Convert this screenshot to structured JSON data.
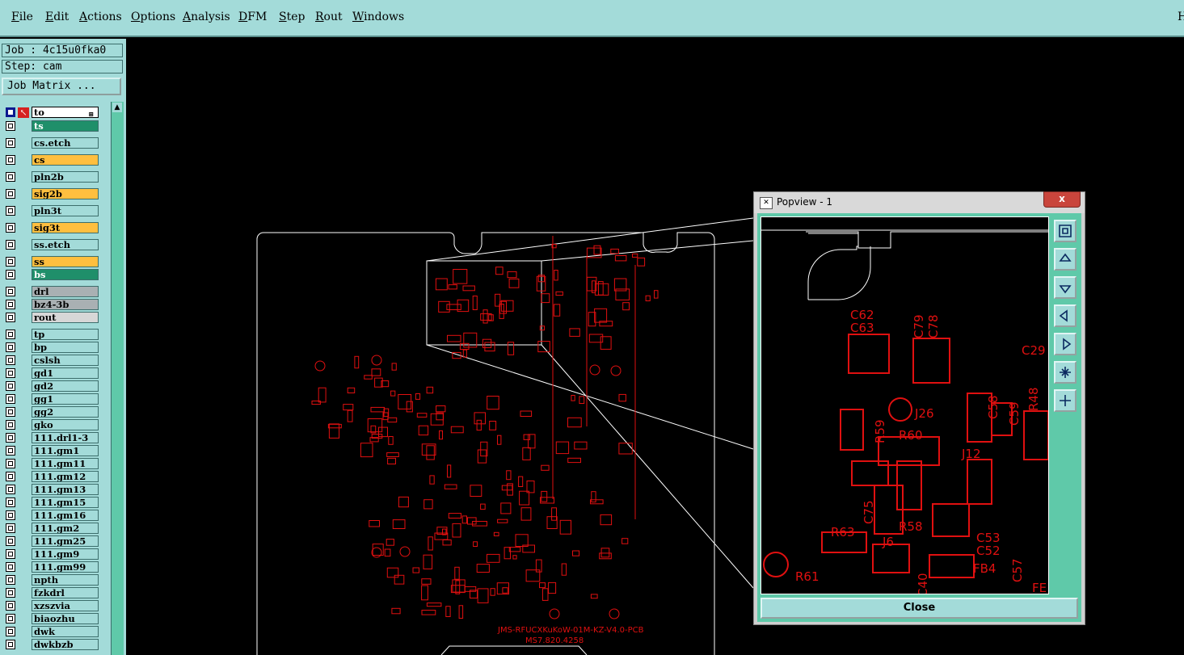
{
  "menu": [
    "File",
    "Edit",
    "Actions",
    "Options",
    "Analysis",
    "DFM",
    "Step",
    "Rout",
    "Windows"
  ],
  "menu_right": "H",
  "job_label": "Job : 4c15u0fka0",
  "step_label": "Step: cam",
  "job_matrix_button": "Job Matrix ...",
  "layer_filter_value": "to",
  "layers": [
    {
      "name": "ts",
      "color": "green"
    },
    {
      "name": "cs.etch",
      "color": "cyan"
    },
    {
      "name": "cs",
      "color": "orange"
    },
    {
      "name": "pln2b",
      "color": "cyan"
    },
    {
      "name": "sig2b",
      "color": "orange"
    },
    {
      "name": "pln3t",
      "color": "cyan"
    },
    {
      "name": "sig3t",
      "color": "orange"
    },
    {
      "name": "ss.etch",
      "color": "cyan"
    },
    {
      "name": "ss",
      "color": "orange"
    },
    {
      "name": "bs",
      "color": "green"
    },
    {
      "name": "drl",
      "color": "grey"
    },
    {
      "name": "bz4-3b",
      "color": "grey"
    },
    {
      "name": "rout",
      "color": "lgrey"
    },
    {
      "name": "tp",
      "color": "cyan"
    },
    {
      "name": "bp",
      "color": "cyan"
    },
    {
      "name": "cslsh",
      "color": "cyan"
    },
    {
      "name": "gd1",
      "color": "cyan"
    },
    {
      "name": "gd2",
      "color": "cyan"
    },
    {
      "name": "gg1",
      "color": "cyan"
    },
    {
      "name": "gg2",
      "color": "cyan"
    },
    {
      "name": "gko",
      "color": "cyan"
    },
    {
      "name": "111.drl1-3",
      "color": "cyan"
    },
    {
      "name": "111.gm1",
      "color": "cyan"
    },
    {
      "name": "111.gm11",
      "color": "cyan"
    },
    {
      "name": "111.gm12",
      "color": "cyan"
    },
    {
      "name": "111.gm13",
      "color": "cyan"
    },
    {
      "name": "111.gm15",
      "color": "cyan"
    },
    {
      "name": "111.gm16",
      "color": "cyan"
    },
    {
      "name": "111.gm2",
      "color": "cyan"
    },
    {
      "name": "111.gm25",
      "color": "cyan"
    },
    {
      "name": "111.gm9",
      "color": "cyan"
    },
    {
      "name": "111.gm99",
      "color": "cyan"
    },
    {
      "name": "npth",
      "color": "cyan"
    },
    {
      "name": "fzkdrl",
      "color": "cyan"
    },
    {
      "name": "xzszvia",
      "color": "cyan"
    },
    {
      "name": "biaozhu",
      "color": "cyan"
    },
    {
      "name": "dwk",
      "color": "cyan"
    },
    {
      "name": "dwkbzb",
      "color": "cyan"
    }
  ],
  "pcb_text": {
    "line1": "JMS-RFUCXKuKoW-01M-KZ-V4.0-PCB",
    "line2": "MS7.820.4258"
  },
  "popview": {
    "title": "Popview - 1",
    "close_x": "x",
    "close_button": "Close",
    "labels": [
      "C62",
      "C63",
      "C79",
      "C78",
      "C29",
      "C58",
      "R48",
      "C59",
      "R59",
      "R60",
      "J26",
      "J12",
      "C75",
      "R58",
      "R63",
      "J6",
      "C53",
      "C52",
      "C57",
      "R61",
      "C40",
      "FB4",
      "FE"
    ]
  },
  "colors": {
    "menu_bg": "#a3dbd9",
    "pcb_trace": "#e01010",
    "outline": "#ffffff",
    "highlight": "#40e0e0"
  }
}
